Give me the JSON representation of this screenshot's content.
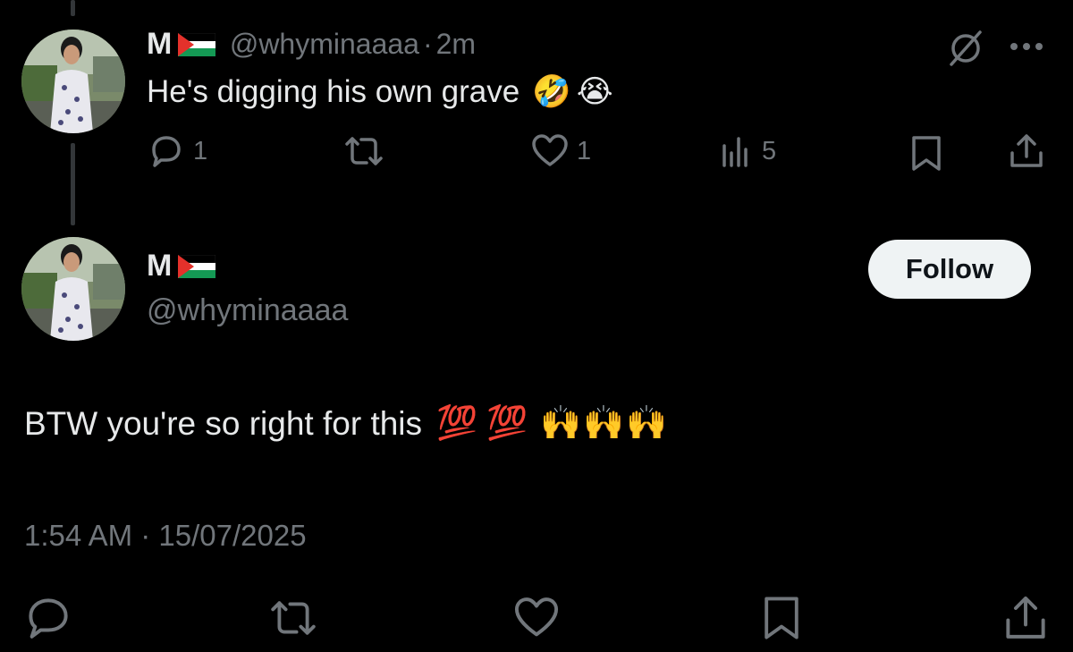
{
  "reply": {
    "display_name": "M",
    "flag_icon": "palestine-flag-icon",
    "handle": "@whyminaaaa",
    "separator": "·",
    "time": "2m",
    "text": "He's digging his own grave",
    "emojis": [
      "🤣",
      "😭"
    ],
    "actions": {
      "replies": "1",
      "reposts": "",
      "likes": "1",
      "views": "5"
    }
  },
  "main_tweet": {
    "display_name": "M",
    "flag_icon": "palestine-flag-icon",
    "handle": "@whyminaaaa",
    "follow_label": "Follow",
    "text": "BTW you're so right for this",
    "emojis": [
      "💯",
      "💯",
      "🙌",
      "🙌",
      "🙌"
    ],
    "timestamp": "1:54 AM · 15/07/2025"
  },
  "colors": {
    "background": "#000000",
    "primary_text": "#e7e9ea",
    "secondary_text": "#71767b",
    "follow_bg": "#eff3f4",
    "follow_text": "#0f1419",
    "thread_line": "#333639"
  }
}
